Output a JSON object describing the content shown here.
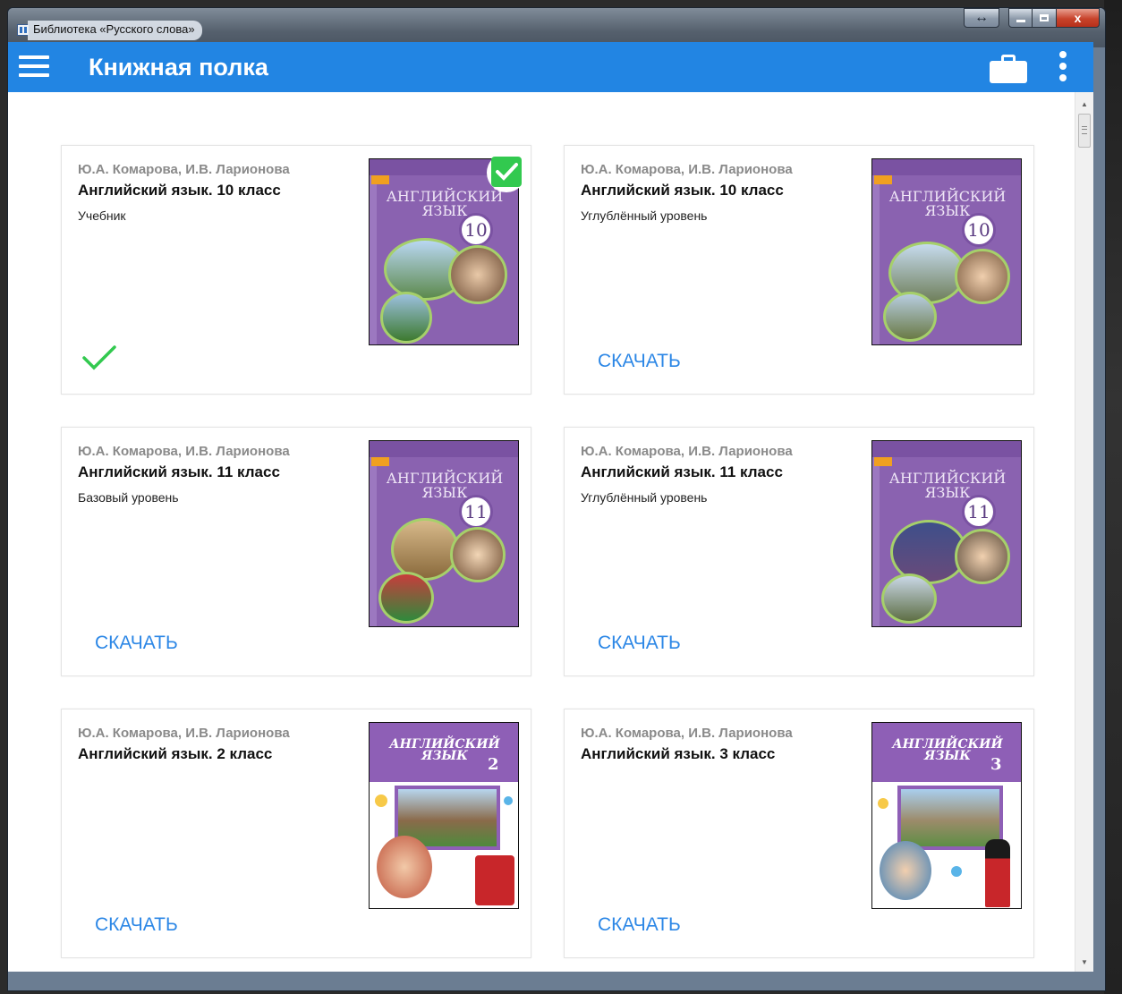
{
  "window": {
    "title": "Библиотека «Русского слова»",
    "buttons": {
      "minimize": "–",
      "maximize": "□",
      "close": "x",
      "resize": "↔"
    }
  },
  "appbar": {
    "title": "Книжная полка",
    "icons": [
      "menu-icon",
      "briefcase-icon",
      "more-vert-icon"
    ]
  },
  "colors": {
    "appbar": "#2285e3",
    "download": "#2c87e6",
    "check": "#32c94f",
    "cover_purple": "#8a62b0"
  },
  "books": [
    {
      "author": "Ю.А. Комарова, И.В. Ларионова",
      "title": "Английский язык. 10 класс",
      "subtitle": "Учебник",
      "status": "downloaded",
      "cover_title": "АНГЛИЙСКИЙ ЯЗЫК",
      "grade": "10"
    },
    {
      "author": "Ю.А. Комарова, И.В. Ларионова",
      "title": "Английский язык. 10 класс",
      "subtitle": "Углублённый уровень",
      "status": "available",
      "action": "СКАЧАТЬ",
      "cover_title": "АНГЛИЙСКИЙ ЯЗЫК",
      "grade": "10"
    },
    {
      "author": "Ю.А. Комарова, И.В. Ларионова",
      "title": "Английский язык. 11 класс",
      "subtitle": "Базовый уровень",
      "status": "available",
      "action": "СКАЧАТЬ",
      "cover_title": "АНГЛИЙСКИЙ ЯЗЫК",
      "grade": "11"
    },
    {
      "author": "Ю.А. Комарова, И.В. Ларионова",
      "title": "Английский язык. 11 класс",
      "subtitle": "Углублённый уровень",
      "status": "available",
      "action": "СКАЧАТЬ",
      "cover_title": "АНГЛИЙСКИЙ ЯЗЫК",
      "grade": "11"
    },
    {
      "author": "Ю.А. Комарова, И.В. Ларионова",
      "title": "Английский язык. 2 класс",
      "subtitle": "",
      "status": "available",
      "action": "СКАЧАТЬ",
      "cover_title": "АНГЛИЙСКИЙ ЯЗЫК",
      "grade": "2"
    },
    {
      "author": "Ю.А. Комарова, И.В. Ларионова",
      "title": "Английский язык. 3 класс",
      "subtitle": "",
      "status": "available",
      "action": "СКАЧАТЬ",
      "cover_title": "АНГЛИЙСКИЙ ЯЗЫК",
      "grade": "3"
    }
  ]
}
